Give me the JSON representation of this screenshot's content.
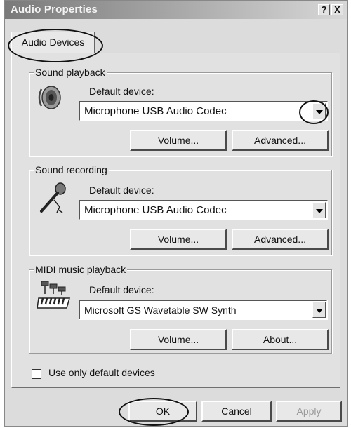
{
  "window": {
    "title": "Audio Properties",
    "help_label": "?",
    "close_label": "X"
  },
  "tab": {
    "label": "Audio Devices"
  },
  "sound_playback": {
    "group_label": "Sound playback",
    "device_label": "Default device:",
    "device_value": "Microphone USB Audio Codec",
    "volume_label": "Volume...",
    "advanced_label": "Advanced...",
    "icon": "speaker-icon"
  },
  "sound_recording": {
    "group_label": "Sound recording",
    "device_label": "Default device:",
    "device_value": "Microphone USB Audio Codec",
    "volume_label": "Volume...",
    "advanced_label": "Advanced...",
    "icon": "microphone-icon"
  },
  "midi_playback": {
    "group_label": "MIDI music playback",
    "device_label": "Default device:",
    "device_value": "Microsoft GS Wavetable SW Synth",
    "volume_label": "Volume...",
    "about_label": "About...",
    "icon": "midi-keyboard-icon"
  },
  "options": {
    "use_default_label": "Use only default devices",
    "use_default_checked": false
  },
  "buttons": {
    "ok_label": "OK",
    "cancel_label": "Cancel",
    "apply_label": "Apply"
  }
}
